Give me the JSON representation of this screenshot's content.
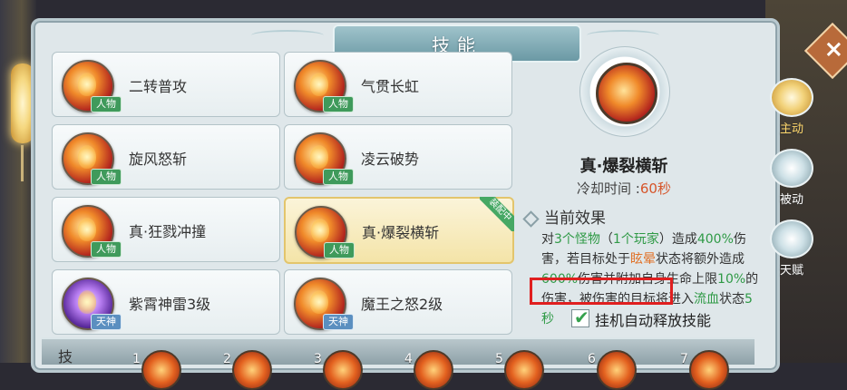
{
  "window": {
    "title": "技能"
  },
  "skills": [
    {
      "name": "二转普攻",
      "tag": "人物",
      "tag_type": "human",
      "icon": "fire-slash-icon"
    },
    {
      "name": "气贯长虹",
      "tag": "人物",
      "tag_type": "human",
      "icon": "fire-orb-icon"
    },
    {
      "name": "旋风怒斩",
      "tag": "人物",
      "tag_type": "human",
      "icon": "whirlwind-icon"
    },
    {
      "name": "凌云破势",
      "tag": "人物",
      "tag_type": "human",
      "icon": "burst-icon"
    },
    {
      "name": "真·狂戮冲撞",
      "tag": "人物",
      "tag_type": "human",
      "icon": "charge-icon"
    },
    {
      "name": "真·爆裂横斩",
      "tag": "人物",
      "tag_type": "human",
      "icon": "explosive-slash-icon",
      "selected": true,
      "badge": "装配中"
    },
    {
      "name": "紫霄神雷3级",
      "tag": "天神",
      "tag_type": "god",
      "icon": "purple-thunder-icon"
    },
    {
      "name": "魔王之怒2级",
      "tag": "天神",
      "tag_type": "god",
      "icon": "demon-wrath-icon"
    }
  ],
  "detail": {
    "name": "真·爆裂横斩",
    "cooldown_label": "冷却时间 :",
    "cooldown_value": "60秒",
    "effect_heading": "当前效果",
    "effect_parts": {
      "p1": "对",
      "p2": "3个怪物",
      "p3": "（",
      "p4": "1个玩家",
      "p5": "）造成",
      "p6": "400%",
      "p7": "伤害，若目标处于",
      "p8": "眩晕",
      "p9": "状态将额外造成",
      "p10": "600%",
      "p11": "伤害并附加自身生命上限",
      "p12": "10%",
      "p13": "的伤害，被伤害的目标将进入",
      "p14": "流血",
      "p15": "状态",
      "p16": "5秒"
    },
    "auto_cast_label": "挂机自动释放技能",
    "auto_cast_checked": true
  },
  "side_tabs": [
    {
      "label": "主动",
      "active": true,
      "icon": "active-skill-icon"
    },
    {
      "label": "被动",
      "active": false,
      "icon": "passive-skill-icon"
    },
    {
      "label": "天赋",
      "active": false,
      "icon": "talent-icon"
    }
  ],
  "hotbar": {
    "label": "技",
    "slots": [
      "1",
      "2",
      "3",
      "4",
      "5",
      "6",
      "7"
    ]
  },
  "close_icon": "close-icon",
  "colors": {
    "highlight_green": "#2f9a46",
    "highlight_orange": "#e0732a",
    "cooldown_red": "#d6552a",
    "annotation_red": "#e01f1f"
  }
}
